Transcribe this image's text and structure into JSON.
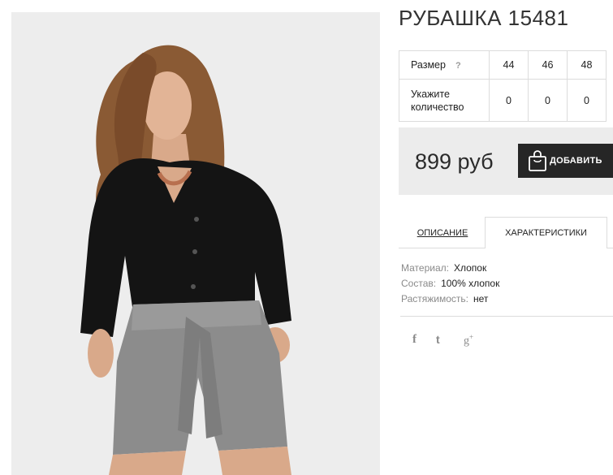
{
  "product": {
    "title": "РУБАШКА 15481",
    "price": "899 руб",
    "add_to_cart_label": "ДОБАВИТЬ"
  },
  "sizes": {
    "size_label": "Размер",
    "help_icon": "?",
    "quantity_label": "Укажите количество",
    "values": [
      "44",
      "46",
      "48"
    ],
    "quantities": [
      "0",
      "0",
      "0"
    ]
  },
  "tabs": [
    {
      "label": "ОПИСАНИЕ",
      "active": false
    },
    {
      "label": "ХАРАКТЕРИСТИКИ",
      "active": true
    }
  ],
  "specs": [
    {
      "key": "Материал:",
      "value": "Хлопок"
    },
    {
      "key": "Состав:",
      "value": "100% хлопок"
    },
    {
      "key": "Растяжимость:",
      "value": "нет"
    }
  ],
  "social": {
    "facebook": "f",
    "twitter": "t",
    "google_plus": "g",
    "google_plus_sup": "+"
  },
  "icons": {
    "cart": "shopping-bag-icon",
    "help": "question-icon"
  },
  "colors": {
    "button_bg": "#262626",
    "price_box_bg": "#ececec",
    "photo_bg": "#ededed"
  }
}
